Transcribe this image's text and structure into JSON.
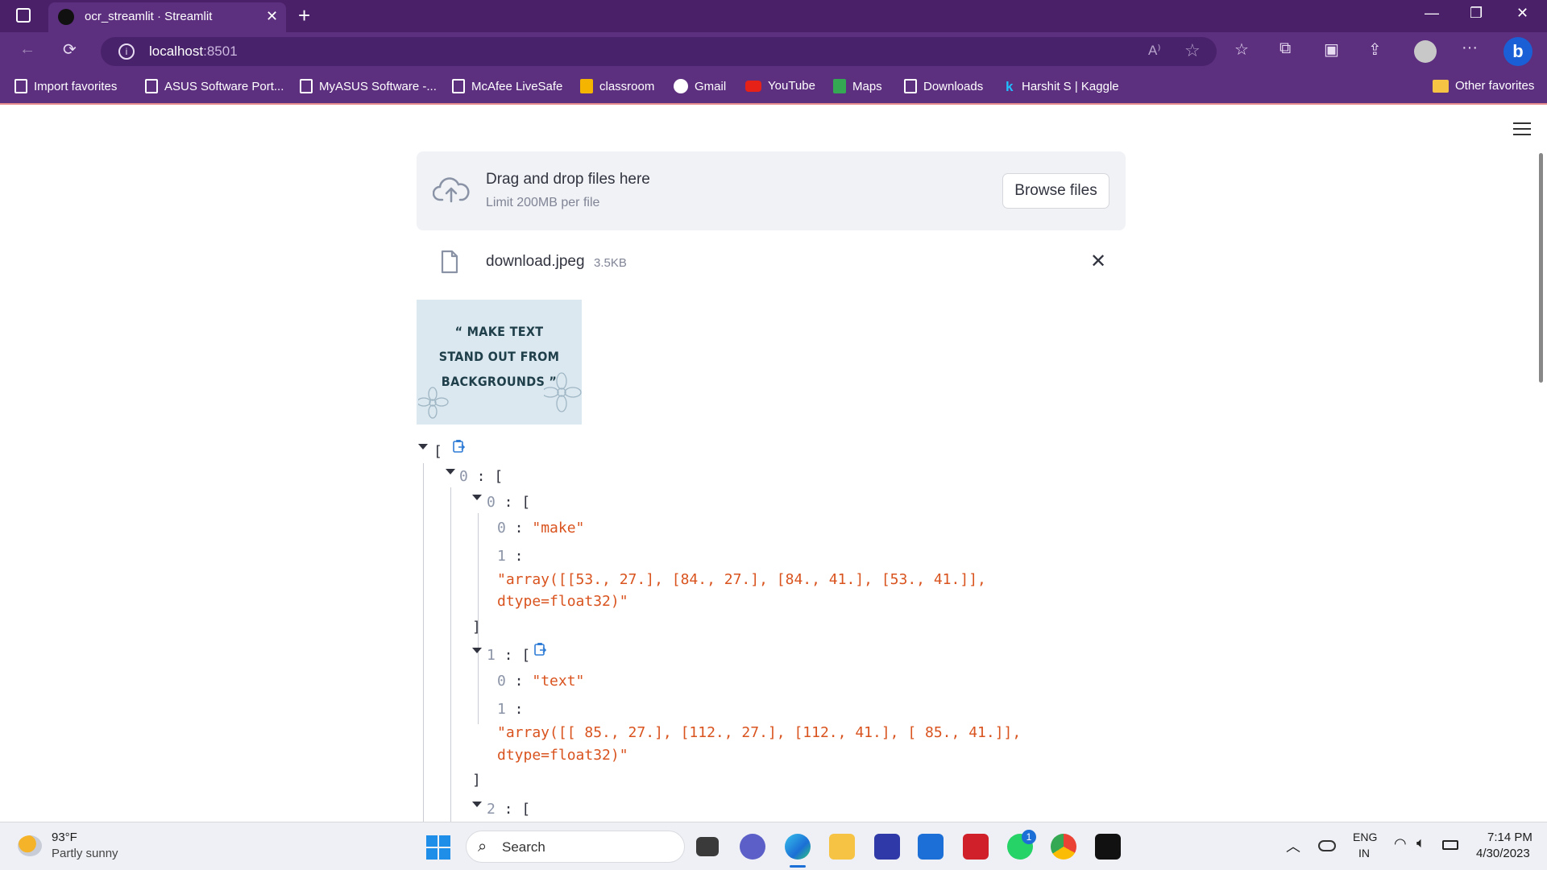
{
  "browser": {
    "tab_title": "ocr_streamlit · Streamlit",
    "url_host": "localhost",
    "url_port": ":8501",
    "favorites": [
      {
        "label": "Import favorites"
      },
      {
        "label": "ASUS Software Port..."
      },
      {
        "label": "MyASUS Software -..."
      },
      {
        "label": "McAfee LiveSafe"
      },
      {
        "label": "classroom"
      },
      {
        "label": "Gmail"
      },
      {
        "label": "YouTube"
      },
      {
        "label": "Maps"
      },
      {
        "label": "Downloads"
      },
      {
        "label": "Harshit S | Kaggle"
      },
      {
        "label": "Other favorites"
      }
    ]
  },
  "uploader": {
    "title": "Drag and drop files here",
    "limit": "Limit 200MB per file",
    "browse_label": "Browse files",
    "file_name": "download.jpeg",
    "file_size": "3.5KB"
  },
  "preview": {
    "line1": "“ MAKE TEXT",
    "line2": "STAND OUT FROM",
    "line3": "BACKGROUNDS ”"
  },
  "json_view": {
    "root_open": "[",
    "item0_key": "0",
    "item0_0_key": "0",
    "item0_0_0_key": "0",
    "item0_0_0_val": "\"make\"",
    "item0_0_1_key": "1",
    "item0_0_1_val_a": "\"array([[53., 27.], [84., 27.], [84., 41.], [53., 41.]],",
    "item0_0_1_val_b": "dtype=float32)\"",
    "item0_1_key": "1",
    "item0_1_0_key": "0",
    "item0_1_0_val": "\"text\"",
    "item0_1_1_key": "1",
    "item0_1_1_val_a": "\"array([[ 85., 27.], [112., 27.], [112., 41.], [ 85., 41.]],",
    "item0_1_1_val_b": "dtype=float32)\"",
    "item0_2_key": "2"
  },
  "taskbar": {
    "weather_temp": "93°F",
    "weather_desc": "Partly sunny",
    "search_label": "Search",
    "lang_top": "ENG",
    "lang_bottom": "IN",
    "time": "7:14 PM",
    "date": "4/30/2023",
    "whatsapp_badge": "1"
  },
  "colors": {
    "titlebar": "#4a2069",
    "toolbar": "#5d2f7f",
    "json_string": "#d9531e",
    "json_key": "#8c95a8"
  }
}
